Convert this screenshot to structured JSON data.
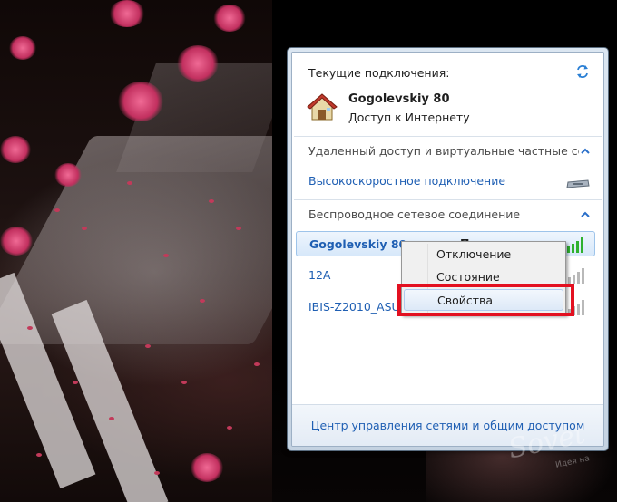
{
  "popup": {
    "current_title": "Текущие подключения:",
    "current_connection": {
      "name": "Gogolevskiy 80",
      "status": "Доступ к Интернету"
    },
    "groups": [
      {
        "label": "Удаленный доступ и виртуальные частные се...",
        "items": [
          {
            "name": "Высокоскоростное подключение",
            "icon": "modem-icon"
          }
        ]
      },
      {
        "label": "Беспроводное сетевое соединение",
        "networks": [
          {
            "name": "Gogolevskiy 80",
            "trailing_text": "П",
            "signal_bars": 5,
            "signal_color": "#2fb12f",
            "selected": true
          },
          {
            "name": "12A",
            "signal_bars": 5,
            "signal_color": "#b9b9b9",
            "selected": false
          },
          {
            "name": "IBIS-Z2010_ASUS",
            "signal_bars": 5,
            "signal_color": "#b9b9b9",
            "selected": false
          }
        ]
      }
    ],
    "footer_link": "Центр управления сетями и общим доступом"
  },
  "context_menu": {
    "items": [
      "Отключение",
      "Состояние",
      "Свойства"
    ],
    "highlighted_index": 2,
    "highlight_color": "#e31020"
  },
  "watermark": {
    "text": "Sovet",
    "sub": "Идея на"
  },
  "colors": {
    "link": "#1f5fb3",
    "text": "#1e1e1e",
    "popup_border": "#5a6d80"
  }
}
